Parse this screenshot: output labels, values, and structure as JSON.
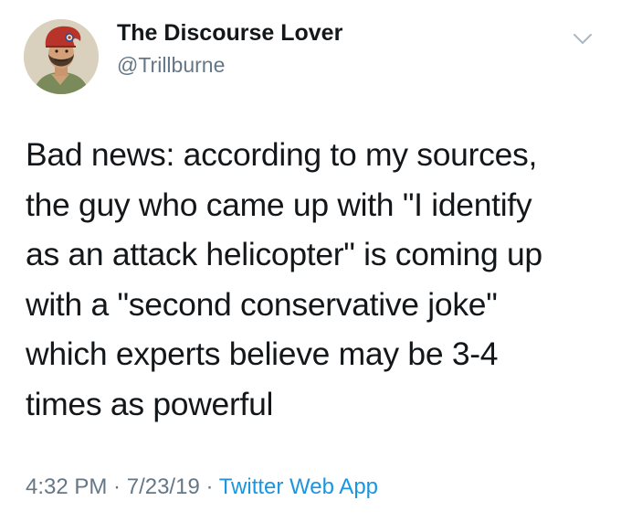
{
  "user": {
    "display_name": "The Discourse Lover",
    "handle": "@Trillburne"
  },
  "tweet": {
    "lines": [
      "Bad news: according to my sources,",
      "the guy who came up with \"I identify",
      "as an attack helicopter\" is coming up",
      "with a \"second conservative joke\"",
      "which experts believe may be 3-4",
      "times as powerful"
    ]
  },
  "meta": {
    "time": "4:32 PM",
    "separator": " · ",
    "date": "7/23/19",
    "source": "Twitter Web App"
  },
  "icons": {
    "menu": "chevron-down-icon",
    "avatar": "avatar-image"
  },
  "colors": {
    "text": "#14171a",
    "secondary": "#657786",
    "link": "#1b95e0"
  }
}
